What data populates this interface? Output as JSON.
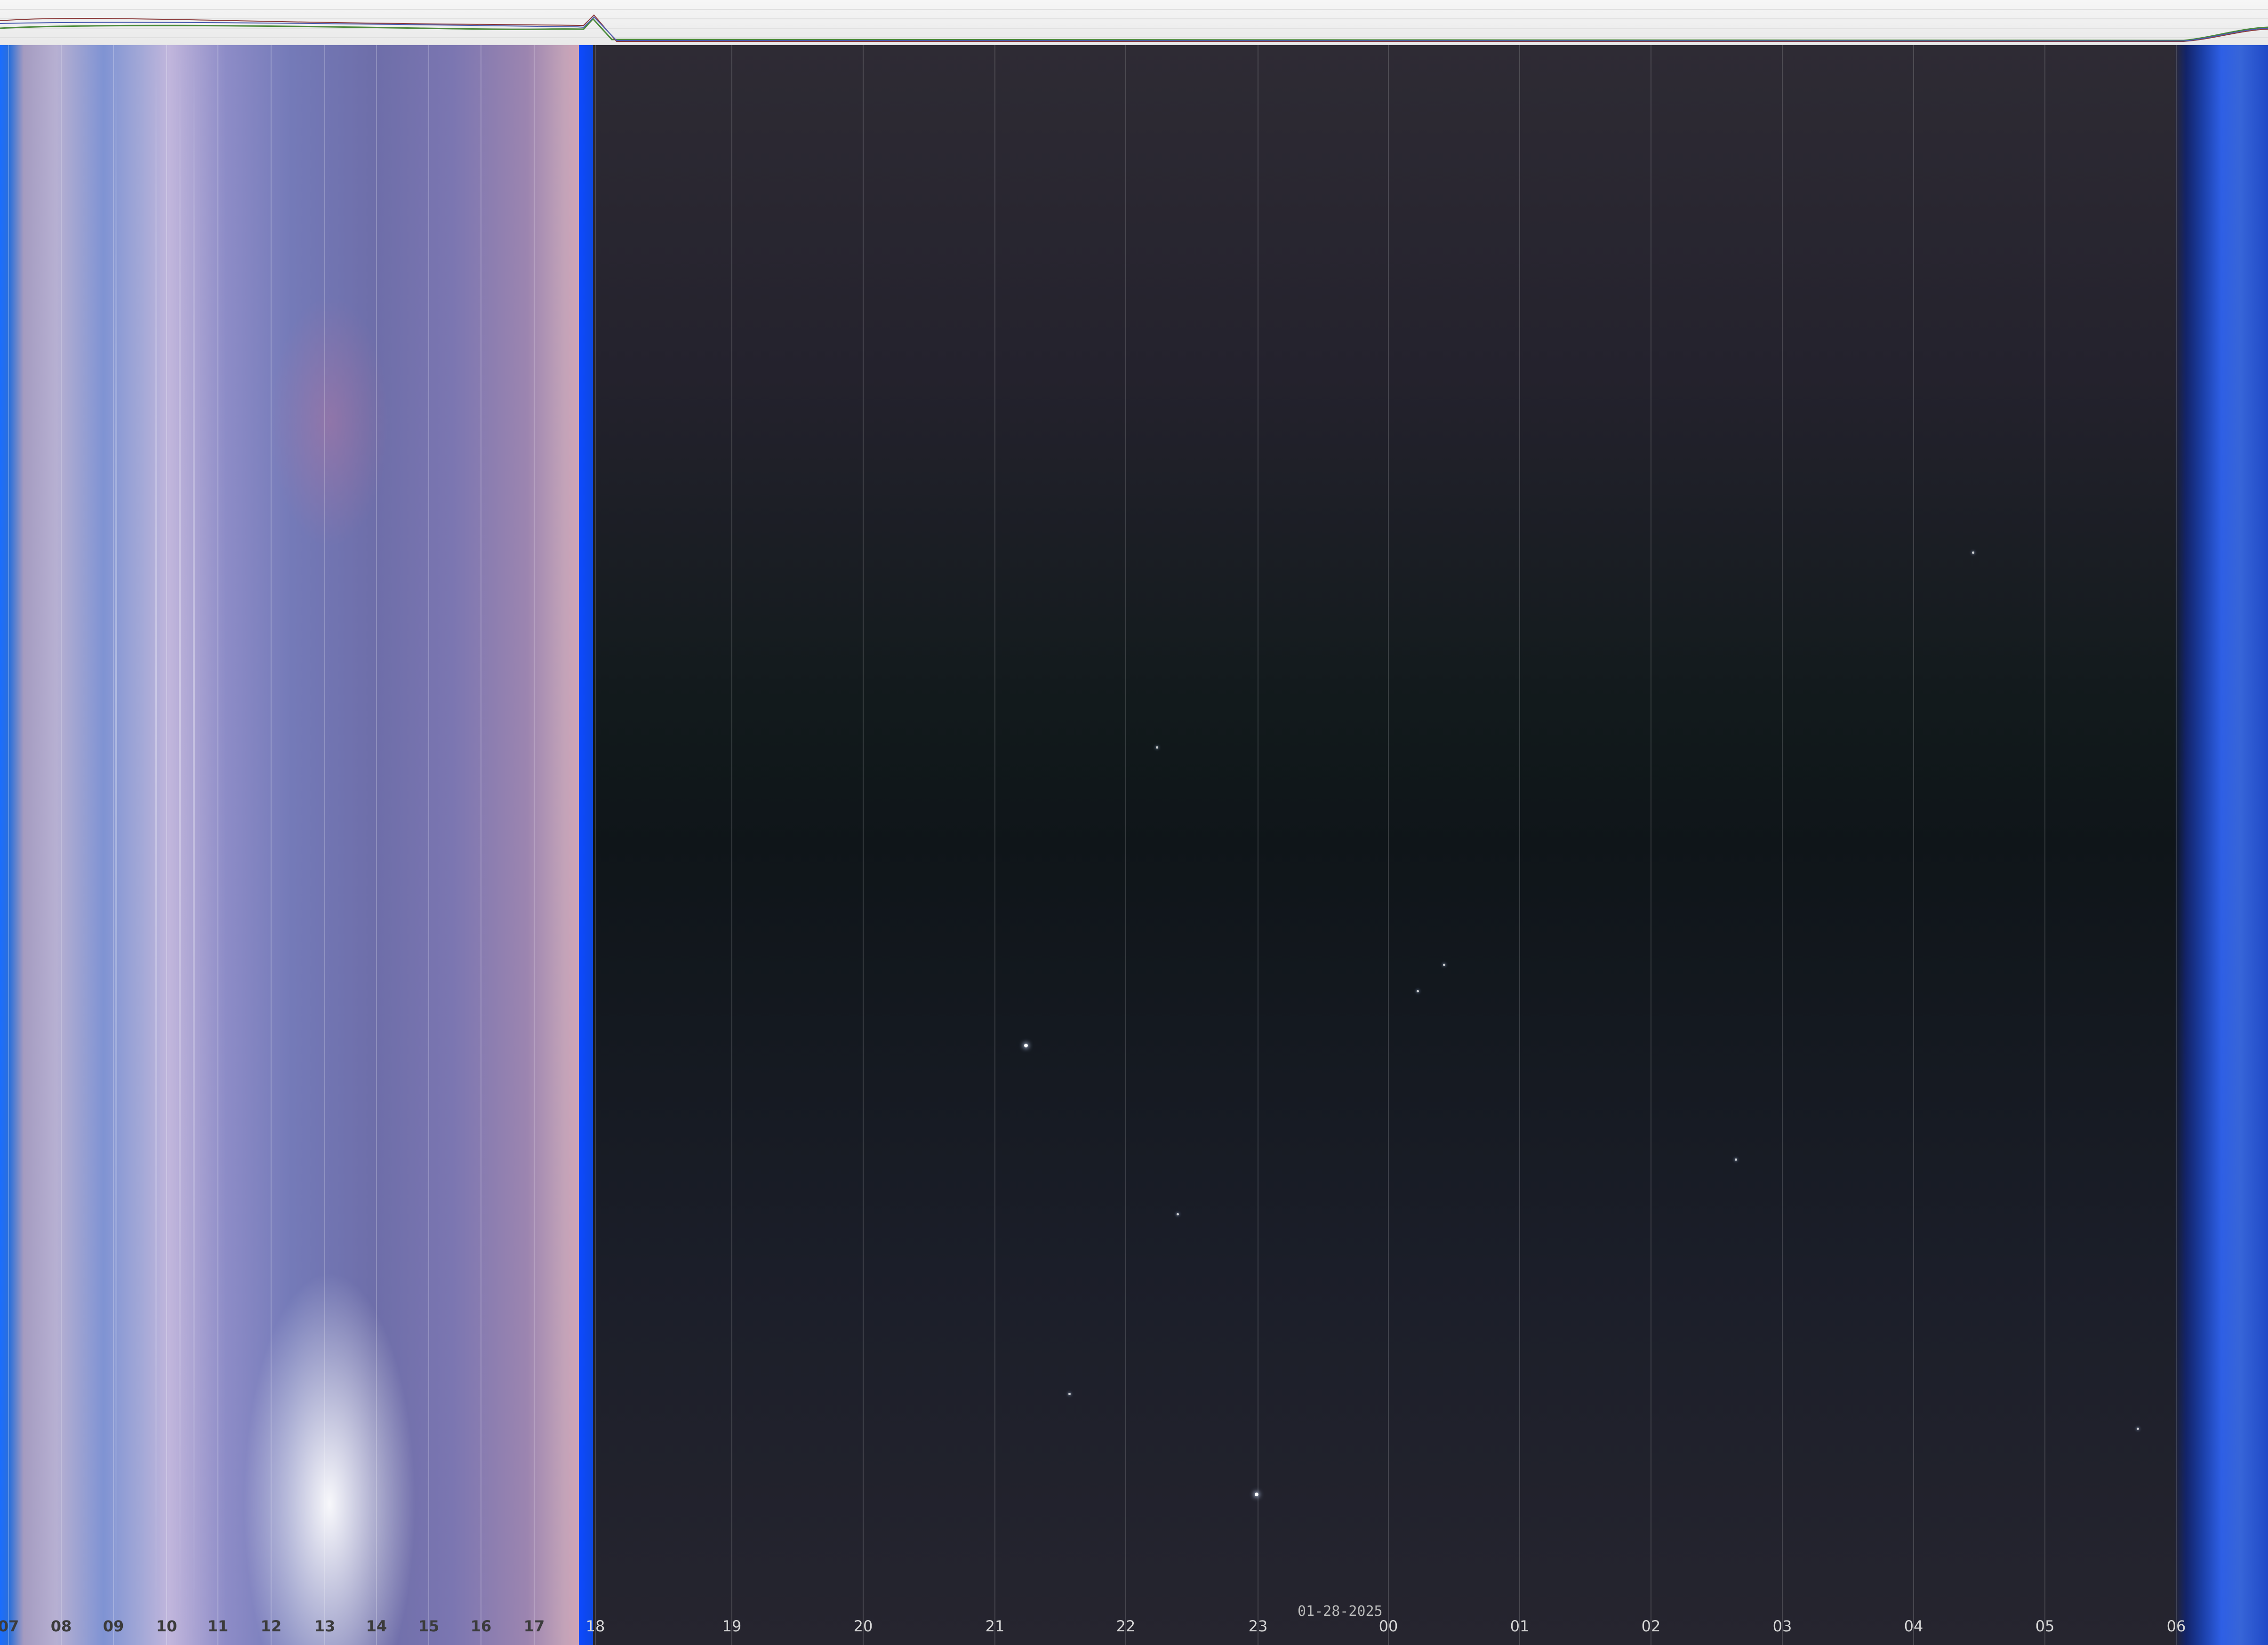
{
  "image": {
    "type": "keogram",
    "date": "01-28-2025",
    "hour_labels": [
      "07",
      "08",
      "09",
      "10",
      "11",
      "12",
      "13",
      "14",
      "15",
      "16",
      "17",
      "18",
      "19",
      "20",
      "21",
      "22",
      "23",
      "00",
      "01",
      "02",
      "03",
      "04",
      "05",
      "06"
    ],
    "colors": {
      "day_sky": "#7f93d3",
      "twilight_blue": "#0d49ff",
      "night_sky": "#121a1c",
      "top_strip": "#f2f2f2"
    }
  }
}
